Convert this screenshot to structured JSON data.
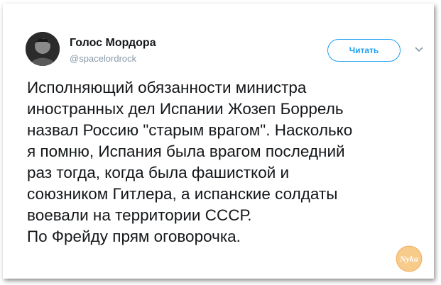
{
  "tweet": {
    "display_name": "Голос Мордора",
    "handle": "@spacelordrock",
    "follow_label": "Читать",
    "text_lines": [
      "Исполняющий обязанности министра",
      "иностранных дел Испании Жозеп Боррель",
      "назвал Россию \"старым врагом\". Насколько",
      "я помню, Испания была врагом последний",
      "раз тогда, когда была фашисткой и",
      "союзником Гитлера, а испанские солдаты",
      "воевали на территории СССР.",
      "По Фрейду прям оговорочка."
    ]
  },
  "watermark": {
    "text": "Nyka"
  },
  "icons": {
    "caret": "chevron-down-icon",
    "avatar": "avatar-image"
  },
  "colors": {
    "accent": "#1da1f2",
    "text": "#14171a",
    "muted": "#8899a6",
    "watermark": "#f2a93b"
  }
}
